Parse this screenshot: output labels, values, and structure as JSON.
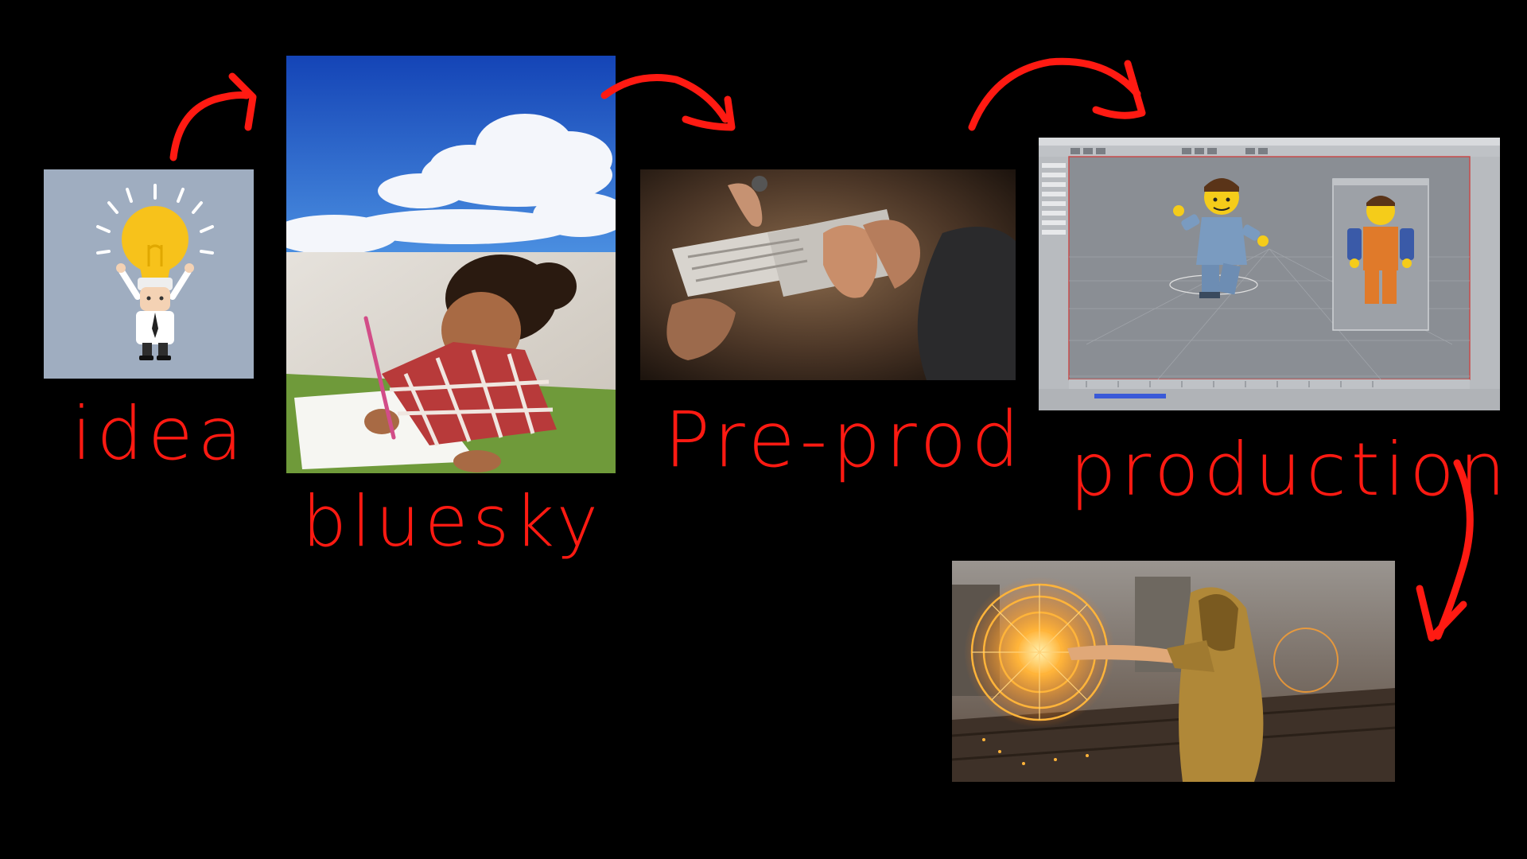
{
  "stages": {
    "idea": {
      "label": "idea"
    },
    "bluesky": {
      "label": "bluesky"
    },
    "preprod": {
      "label": "Pre-prod"
    },
    "production": {
      "label": "production"
    }
  },
  "colors": {
    "background": "#000000",
    "annotation": "#ff1a12",
    "idea_panel_bg": "#9fadc0",
    "sky_blue": "#1e57c8",
    "viewport_gray": "#8a8e94"
  },
  "icons": {
    "idea": "lightbulb-character",
    "bluesky": "clouds-and-child-drawing",
    "preprod": "hands-over-documents",
    "production_top": "3d-animation-software-lego-figures",
    "production_bottom": "sorcerer-magic-circle"
  }
}
